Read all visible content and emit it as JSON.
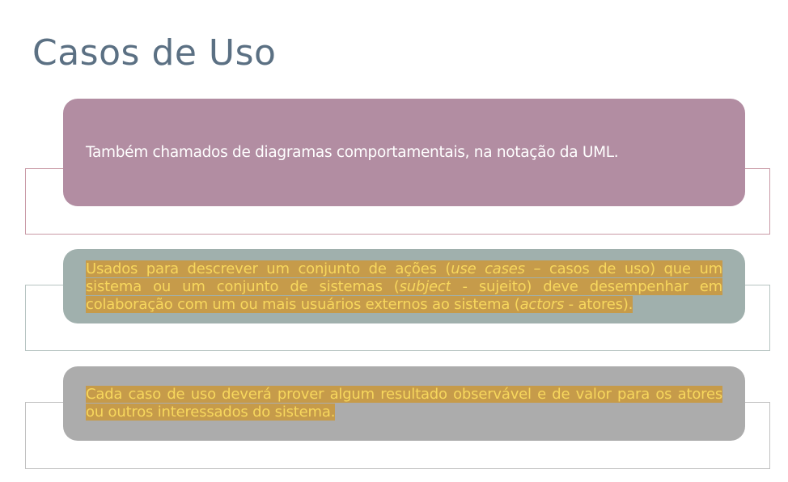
{
  "slide": {
    "title": "Casos de Uso",
    "cards": [
      {
        "text": "Também chamados de diagramas comportamentais, na notação da UML."
      },
      {
        "segments": [
          "Usados para descrever um conjunto de ações (",
          "use cases",
          " – casos de uso) que um sistema ou um conjunto de sistemas (",
          "subject",
          " - sujeito) deve desempenhar em colaboração com um ou mais usuários externos ao sistema (",
          "actors",
          " - atores)."
        ]
      },
      {
        "text": "Cada caso de uso deverá prover algum resultado observável e de valor para os atores ou outros interessados do sistema."
      }
    ]
  },
  "colors": {
    "title": "#5b7083",
    "card1": "#b28da2",
    "card2": "#a0b0ad",
    "card3": "#acacac",
    "highlight_bg": "#c69b4a",
    "highlight_text": "#f7d75d"
  }
}
